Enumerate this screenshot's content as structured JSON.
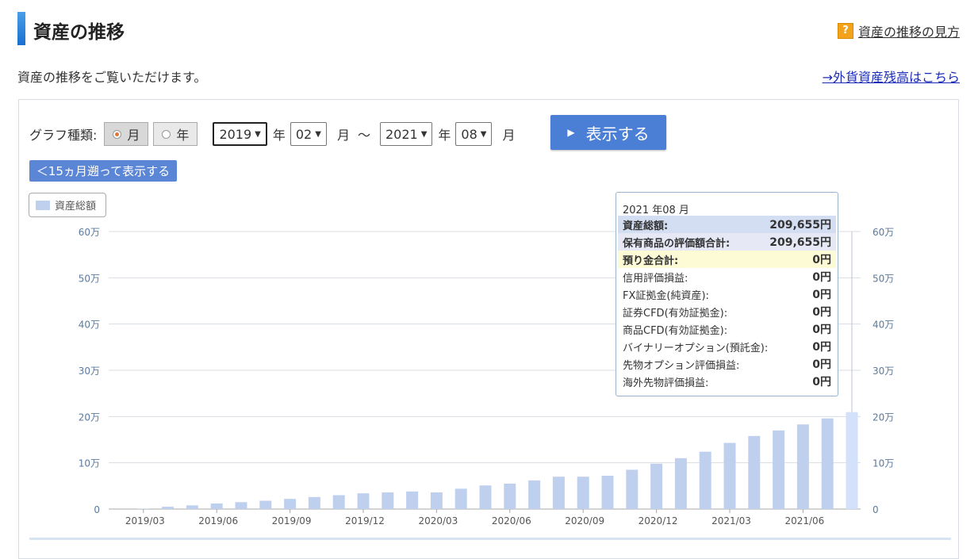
{
  "header": {
    "title": "資産の推移",
    "help_icon": "?",
    "help_link": "資産の推移の見方",
    "description": "資産の推移をご覧いただけます。",
    "fx_link": "→外貨資産残高はこちら"
  },
  "controls": {
    "graph_type_label": "グラフ種類:",
    "option_month": "月",
    "option_year": "年",
    "selected_type": "月",
    "from_year": "2019",
    "from_month": "02",
    "to_year": "2021",
    "to_month": "08",
    "year_unit": "年",
    "month_unit": "月",
    "range_sep": "～",
    "submit_label": "表示する",
    "back15_label": "＜15ヵ月遡って表示する"
  },
  "legend": {
    "label": "資産総額"
  },
  "tooltip": {
    "date": "2021 年08 月",
    "rows": [
      {
        "label": "資産総額:",
        "value": "209,655円",
        "bg": "#d3def2",
        "bold": true
      },
      {
        "label": "保有商品の評価額合計:",
        "value": "209,655円",
        "bg": "#e6e8f6",
        "bold": true
      },
      {
        "label": "預り金合計:",
        "value": "0円",
        "bg": "#fdfad6",
        "bold": true
      },
      {
        "label": "信用評価損益:",
        "value": "0円",
        "bg": "",
        "bold": false
      },
      {
        "label": "FX証拠金(純資産):",
        "value": "0円",
        "bg": "",
        "bold": false
      },
      {
        "label": "証券CFD(有効証拠金):",
        "value": "0円",
        "bg": "",
        "bold": false
      },
      {
        "label": "商品CFD(有効証拠金):",
        "value": "0円",
        "bg": "",
        "bold": false
      },
      {
        "label": "バイナリーオプション(預託金):",
        "value": "0円",
        "bg": "",
        "bold": false
      },
      {
        "label": "先物オプション評価損益:",
        "value": "0円",
        "bg": "",
        "bold": false
      },
      {
        "label": "海外先物評価損益:",
        "value": "0円",
        "bg": "",
        "bold": false
      }
    ]
  },
  "chart_data": {
    "type": "bar",
    "series_name": "資産総額",
    "bar_color": "#bfd0ee",
    "highlight_color": "#d3e1fa",
    "highlight_index": 30,
    "ylim": [
      0,
      600000
    ],
    "y_ticks": [
      0,
      100000,
      200000,
      300000,
      400000,
      500000,
      600000
    ],
    "y_tick_labels": [
      "0",
      "10万",
      "20万",
      "30万",
      "40万",
      "50万",
      "60万"
    ],
    "categories": [
      "2019/02",
      "2019/03",
      "2019/04",
      "2019/05",
      "2019/06",
      "2019/07",
      "2019/08",
      "2019/09",
      "2019/10",
      "2019/11",
      "2019/12",
      "2020/01",
      "2020/02",
      "2020/03",
      "2020/04",
      "2020/05",
      "2020/06",
      "2020/07",
      "2020/08",
      "2020/09",
      "2020/10",
      "2020/11",
      "2020/12",
      "2021/01",
      "2021/02",
      "2021/03",
      "2021/04",
      "2021/05",
      "2021/06",
      "2021/07",
      "2021/08"
    ],
    "x_tick_labels": [
      "",
      "2019/03",
      "",
      "",
      "2019/06",
      "",
      "",
      "2019/09",
      "",
      "",
      "2019/12",
      "",
      "",
      "2020/03",
      "",
      "",
      "2020/06",
      "",
      "",
      "2020/09",
      "",
      "",
      "2020/12",
      "",
      "",
      "2021/03",
      "",
      "",
      "2021/06",
      "",
      ""
    ],
    "values": [
      0,
      1000,
      5000,
      8000,
      12000,
      15000,
      18000,
      22000,
      26000,
      30000,
      34000,
      36000,
      38000,
      36000,
      44000,
      51000,
      55000,
      62000,
      70000,
      70000,
      72000,
      85000,
      98000,
      110000,
      124000,
      143000,
      158000,
      170000,
      183000,
      196000,
      209655
    ]
  }
}
